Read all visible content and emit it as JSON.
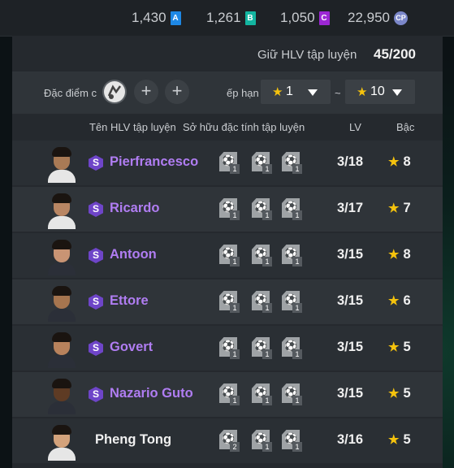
{
  "currencies": [
    {
      "value": "1,430",
      "badge": "A",
      "color": "#1e88e5"
    },
    {
      "value": "1,261",
      "badge": "B",
      "color": "#13b5a0"
    },
    {
      "value": "1,050",
      "badge": "C",
      "color": "#9c27d4"
    },
    {
      "value": "22,950",
      "badge": "CP",
      "color": "#7b87c9"
    }
  ],
  "holding": {
    "label": "Giữ HLV tập luyện",
    "value": "45/200"
  },
  "filter": {
    "trait_label": "Đặc điểm c",
    "add_symbol": "+",
    "rank_label": "ếp hạn",
    "tilde": "~",
    "rank_min": "1",
    "rank_max": "10"
  },
  "columns": {
    "name": "Tên HLV tập luyện",
    "traits": "Sở hữu đặc tính tập luyện",
    "lv": "LV",
    "grade": "Bậc"
  },
  "coaches": [
    {
      "name": "Pierfrancesco",
      "special": true,
      "lv": "3/18",
      "grade": "8",
      "traits": [
        "1",
        "1",
        "1"
      ],
      "skin": "#a97a55",
      "shirt": "#e6e6e6"
    },
    {
      "name": "Ricardo",
      "special": true,
      "lv": "3/17",
      "grade": "7",
      "traits": [
        "1",
        "1",
        "1"
      ],
      "skin": "#b98663",
      "shirt": "#e6e6e6"
    },
    {
      "name": "Antoon",
      "special": true,
      "lv": "3/15",
      "grade": "8",
      "traits": [
        "1",
        "1",
        "1"
      ],
      "skin": "#c99474",
      "shirt": "#2b2f38"
    },
    {
      "name": "Ettore",
      "special": true,
      "lv": "3/15",
      "grade": "6",
      "traits": [
        "1",
        "1",
        "1"
      ],
      "skin": "#a6754f",
      "shirt": "#2b2f38"
    },
    {
      "name": "Govert",
      "special": true,
      "lv": "3/15",
      "grade": "5",
      "traits": [
        "1",
        "1",
        "1"
      ],
      "skin": "#b8825c",
      "shirt": "#2b2f38"
    },
    {
      "name": "Nazario Guto",
      "special": true,
      "lv": "3/15",
      "grade": "5",
      "traits": [
        "1",
        "1",
        "1"
      ],
      "skin": "#5e3b24",
      "shirt": "#2b2f38"
    },
    {
      "name": "Pheng Tong",
      "special": false,
      "lv": "3/16",
      "grade": "5",
      "traits": [
        "2",
        "1",
        "1"
      ],
      "skin": "#d3a27b",
      "shirt": "#e6e6e6"
    }
  ],
  "icons": {
    "trait_glyph": "⚽",
    "star": "★"
  }
}
